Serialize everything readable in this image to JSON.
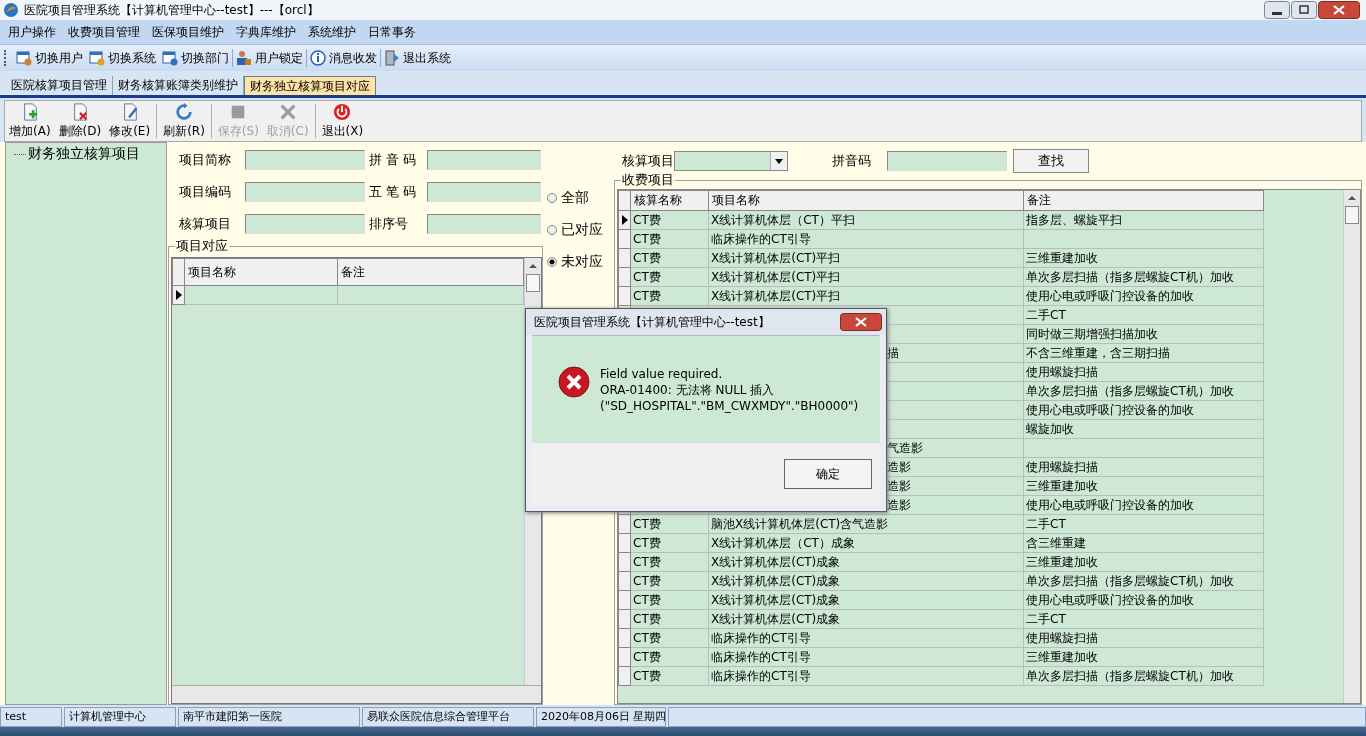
{
  "window": {
    "title": "医院项目管理系统【计算机管理中心--test】---【orcl】"
  },
  "menu": [
    "用户操作",
    "收费项目管理",
    "医保项目维护",
    "字典库维护",
    "系统维护",
    "日常事务"
  ],
  "toolbar": [
    {
      "kind": "user",
      "label": "切换用户"
    },
    {
      "kind": "system",
      "label": "切换系统"
    },
    {
      "kind": "dept",
      "label": "切换部门"
    },
    {
      "kind": "lock",
      "label": "用户锁定"
    },
    {
      "kind": "info",
      "label": "消息收发"
    },
    {
      "kind": "exit",
      "label": "退出系统"
    }
  ],
  "tabs": [
    {
      "label": "医院核算项目管理",
      "selected": false
    },
    {
      "label": "财务核算账簿类别维护",
      "selected": false
    },
    {
      "label": "财务独立核算项目对应",
      "selected": true
    }
  ],
  "actions": [
    {
      "kind": "add",
      "label": "增加(A)",
      "disabled": false
    },
    {
      "kind": "delete",
      "label": "删除(D)",
      "disabled": false
    },
    {
      "kind": "edit",
      "label": "修改(E)",
      "disabled": false
    },
    {
      "kind": "refresh",
      "label": "刷新(R)",
      "disabled": false
    },
    {
      "kind": "save",
      "label": "保存(S)",
      "disabled": true
    },
    {
      "kind": "cancel",
      "label": "取消(C)",
      "disabled": true
    },
    {
      "kind": "exit",
      "label": "退出(X)",
      "disabled": false
    }
  ],
  "tree": {
    "items": [
      {
        "label": "财务独立核算项目"
      }
    ]
  },
  "form": {
    "fields": [
      {
        "label": "项目简称"
      },
      {
        "label": "拼 音 码"
      },
      {
        "label": "项目编码"
      },
      {
        "label": "五 笔 码"
      },
      {
        "label": "核算项目"
      },
      {
        "label": "排序号"
      }
    ]
  },
  "filter": [
    {
      "label": "全部",
      "selected": false
    },
    {
      "label": "已对应",
      "selected": false
    },
    {
      "label": "未对应",
      "selected": true
    }
  ],
  "mapping": {
    "title": "项目对应",
    "columns": [
      "项目名称",
      "备注"
    ],
    "rows": [
      {
        "current": true
      }
    ]
  },
  "search": {
    "label": "核算项目",
    "pinyin_label": "拼音码",
    "button": "查找"
  },
  "charges": {
    "title": "收费项目",
    "columns": [
      "核算名称",
      "项目名称",
      "备注"
    ],
    "rows": [
      {
        "current": true,
        "category": "CT费",
        "name": "X线计算机体层（CT）平扫",
        "note": "指多层、螺旋平扫"
      },
      {
        "current": false,
        "category": "CT费",
        "name": "临床操作的CT引导"
      },
      {
        "current": false,
        "category": "CT费",
        "name": "X线计算机体层(CT)平扫",
        "note": "三维重建加收"
      },
      {
        "current": false,
        "category": "CT费",
        "name": "X线计算机体层(CT)平扫",
        "note": "单次多层扫描（指多层螺旋CT机）加收"
      },
      {
        "current": false,
        "category": "CT费",
        "name": "X线计算机体层(CT)平扫",
        "note": "使用心电或呼吸门控设备的加收"
      },
      {
        "note": "二手CT"
      },
      {
        "note": "同时做三期增强扫描加收"
      },
      {
        "name_tail": "描",
        "note": "不含三维重建，含三期扫描"
      },
      {
        "note": "使用螺旋扫描"
      },
      {
        "note": "单次多层扫描（指多层螺旋CT机）加收"
      },
      {
        "note": "使用心电或呼吸门控设备的加收"
      },
      {
        "note": "螺旋加收"
      },
      {
        "name_tail": "气造影"
      },
      {
        "name_tail": "造影",
        "note": "使用螺旋扫描"
      },
      {
        "name_tail": "造影",
        "note": "三维重建加收"
      },
      {
        "name_tail": "造影",
        "note": "使用心电或呼吸门控设备的加收"
      },
      {
        "current": false,
        "category": "CT费",
        "name": "脑池X线计算机体层(CT)含气造影",
        "note": "二手CT"
      },
      {
        "current": false,
        "category": "CT费",
        "name": "X线计算机体层（CT）成象",
        "note": "含三维重建"
      },
      {
        "current": false,
        "category": "CT费",
        "name": "X线计算机体层(CT)成象",
        "note": "三维重建加收"
      },
      {
        "current": false,
        "category": "CT费",
        "name": "X线计算机体层(CT)成象",
        "note": "单次多层扫描（指多层螺旋CT机）加收"
      },
      {
        "current": false,
        "category": "CT费",
        "name": "X线计算机体层(CT)成象",
        "note": "使用心电或呼吸门控设备的加收"
      },
      {
        "current": false,
        "category": "CT费",
        "name": "X线计算机体层(CT)成象",
        "note": "二手CT"
      },
      {
        "current": false,
        "category": "CT费",
        "name": "临床操作的CT引导",
        "note": "使用螺旋扫描"
      },
      {
        "current": false,
        "category": "CT费",
        "name": "临床操作的CT引导",
        "note": "三维重建加收"
      },
      {
        "current": false,
        "category": "CT费",
        "name": "临床操作的CT引导",
        "note": "单次多层扫描（指多层螺旋CT机）加收"
      }
    ]
  },
  "dialog": {
    "title": "医院项目管理系统【计算机管理中心--test】",
    "lines": [
      "Field value required.",
      "ORA-01400: 无法将 NULL 插入",
      "(\"SD_HOSPITAL\".\"BM_CWXMDY\".\"BH0000\")"
    ],
    "button": "确定"
  },
  "status_bar": [
    "test",
    "计算机管理中心",
    "南平市建阳第一医院",
    "易联众医院信息综合管理平台",
    "2020年08月06日 星期四"
  ]
}
